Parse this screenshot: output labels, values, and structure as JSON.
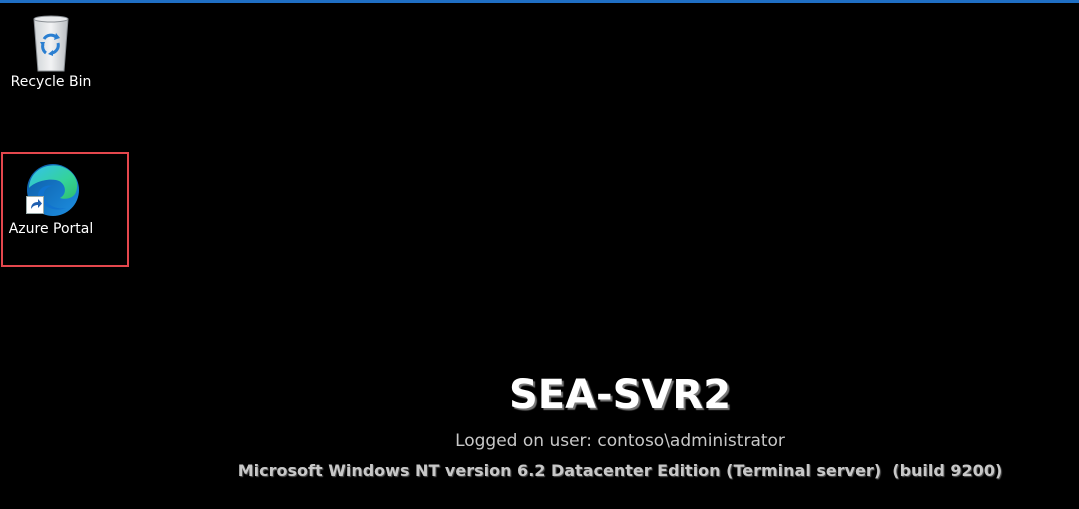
{
  "desktop": {
    "icons": [
      {
        "label": "Recycle Bin",
        "icon": "recycle-bin-icon"
      },
      {
        "label": "Azure Portal",
        "icon": "edge-browser-icon",
        "shortcut": true
      }
    ],
    "highlight_color": "#e4474d",
    "background_color": "#000000",
    "accent_color": "#1f6fc4"
  },
  "bginfo": {
    "host_name": "SEA-SVR2",
    "logged_user": "Logged on user: contoso\\administrator",
    "os_version": "Microsoft Windows NT version 6.2 Datacenter Edition (Terminal server)  (build 9200)"
  }
}
